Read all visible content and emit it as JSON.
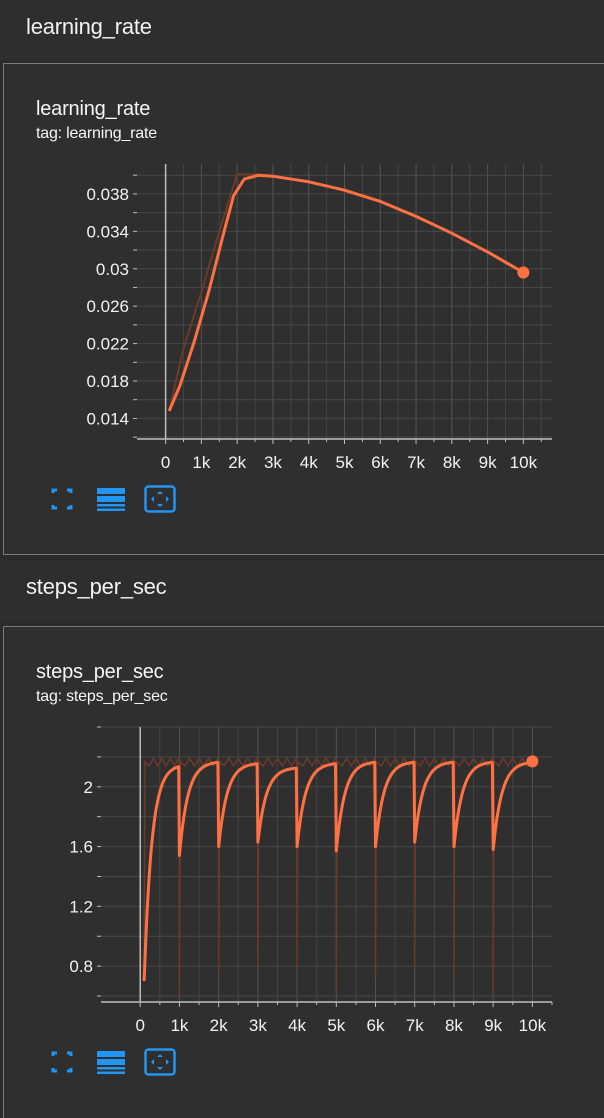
{
  "sections": [
    {
      "header": "learning_rate"
    },
    {
      "header": "steps_per_sec"
    }
  ],
  "colors": {
    "smoothed": "#ff7043",
    "raw": "#6b3a2c",
    "accent": "#2196f3",
    "grid": "#555555",
    "axis": "#bdbdbd"
  },
  "icons": [
    "fullscreen-icon",
    "data-table-icon",
    "fit-domain-icon"
  ],
  "chart_data": [
    {
      "type": "line",
      "title": "learning_rate",
      "subtitle": "tag: learning_rate",
      "xlabel": "",
      "ylabel": "",
      "xlim": [
        -800,
        10800
      ],
      "ylim": [
        0.0118,
        0.0412
      ],
      "xticks": [
        0,
        1000,
        2000,
        3000,
        4000,
        5000,
        6000,
        7000,
        8000,
        9000,
        10000
      ],
      "xtick_labels": [
        "0",
        "1k",
        "2k",
        "3k",
        "4k",
        "5k",
        "6k",
        "7k",
        "8k",
        "9k",
        "10k"
      ],
      "yticks": [
        0.014,
        0.018,
        0.022,
        0.026,
        0.03,
        0.034,
        0.038
      ],
      "ytick_labels": [
        "0.014",
        "0.018",
        "0.022",
        "0.026",
        "0.03",
        "0.034",
        "0.038"
      ],
      "grid": true,
      "series": [
        {
          "role": "raw",
          "x": [
            100,
            500,
            1000,
            1500,
            2000,
            2500,
            3000,
            4000,
            5000,
            6000,
            7000,
            8000,
            9000,
            10000
          ],
          "y": [
            0.0148,
            0.0215,
            0.0275,
            0.034,
            0.0401,
            0.0401,
            0.0399,
            0.0393,
            0.0384,
            0.0372,
            0.0356,
            0.0338,
            0.0318,
            0.0296
          ]
        },
        {
          "role": "smoothed",
          "x": [
            100,
            400,
            800,
            1200,
            1600,
            1900,
            2200,
            2600,
            3000,
            4000,
            5000,
            6000,
            7000,
            8000,
            9000,
            10000
          ],
          "y": [
            0.0148,
            0.0175,
            0.0222,
            0.0275,
            0.0335,
            0.0378,
            0.0396,
            0.04,
            0.0399,
            0.0393,
            0.0384,
            0.0372,
            0.0356,
            0.0338,
            0.0318,
            0.0296
          ]
        }
      ],
      "last_point": {
        "x": 10000,
        "y": 0.0296
      }
    },
    {
      "type": "line",
      "title": "steps_per_sec",
      "subtitle": "tag: steps_per_sec",
      "xlabel": "",
      "ylabel": "",
      "xlim": [
        -1000,
        10500
      ],
      "ylim": [
        0.56,
        2.4
      ],
      "xticks": [
        0,
        1000,
        2000,
        3000,
        4000,
        5000,
        6000,
        7000,
        8000,
        9000,
        10000
      ],
      "xtick_labels": [
        "0",
        "1k",
        "2k",
        "3k",
        "4k",
        "5k",
        "6k",
        "7k",
        "8k",
        "9k",
        "10k"
      ],
      "yticks": [
        0.8,
        1.2,
        1.6,
        2
      ],
      "ytick_labels": [
        "0.8",
        "1.2",
        "1.6",
        "2"
      ],
      "grid": true,
      "cycles": {
        "starts": [
          100,
          1000,
          2000,
          3000,
          4000,
          5000,
          6000,
          7000,
          8000,
          9000
        ],
        "start_values": [
          0.7,
          1.54,
          1.6,
          1.63,
          1.6,
          1.57,
          1.6,
          1.63,
          1.6,
          1.58
        ],
        "peaks": [
          2.15,
          2.17,
          2.16,
          2.13,
          2.16,
          2.17,
          2.17,
          2.17,
          2.17,
          2.17
        ],
        "dips": [
          0.7,
          0.6,
          0.75,
          0.77,
          0.79,
          0.62,
          0.72,
          0.79,
          0.74,
          0.62
        ],
        "ends": [
          1000,
          2000,
          3000,
          4000,
          5000,
          6000,
          7000,
          8000,
          9000,
          10000
        ],
        "raw_level": 2.17
      },
      "last_point": {
        "x": 10000,
        "y": 2.17
      }
    }
  ]
}
